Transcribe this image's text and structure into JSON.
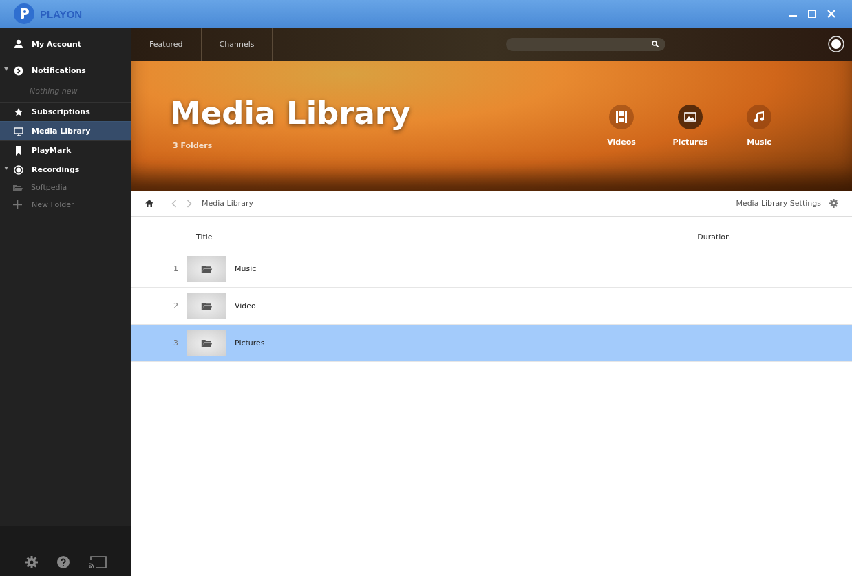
{
  "window": {
    "title": "PLAYON"
  },
  "sidebar": {
    "items": [
      {
        "label": "My Account",
        "selected": false
      },
      {
        "label": "Notifications",
        "selected": false,
        "expanded": true,
        "children": [
          {
            "label": "Nothing new",
            "kind": "note"
          }
        ]
      },
      {
        "label": "Subscriptions",
        "selected": false
      },
      {
        "label": "Media Library",
        "selected": true
      },
      {
        "label": "PlayMark",
        "selected": false
      },
      {
        "label": "Recordings",
        "selected": false,
        "expanded": true,
        "children": [
          {
            "label": "Softpedia",
            "kind": "folder"
          },
          {
            "label": "New Folder",
            "kind": "add"
          }
        ]
      }
    ]
  },
  "nav_tabs": [
    {
      "label": "Featured",
      "selected": false
    },
    {
      "label": "Channels",
      "selected": false
    }
  ],
  "hero": {
    "title": "Media Library",
    "subtitle": "3 Folders",
    "media_types": [
      {
        "label": "Videos",
        "selected": false
      },
      {
        "label": "Pictures",
        "selected": true
      },
      {
        "label": "Music",
        "selected": false
      }
    ]
  },
  "breadcrumb": {
    "path": "Media Library",
    "settings": "Media Library Settings"
  },
  "table": {
    "columns": [
      "Title",
      "Duration"
    ],
    "rows": [
      {
        "number": "1",
        "title": "Music",
        "selected": false
      },
      {
        "number": "2",
        "title": "Video",
        "selected": false
      },
      {
        "number": "3",
        "title": "Pictures",
        "selected": true
      }
    ]
  }
}
